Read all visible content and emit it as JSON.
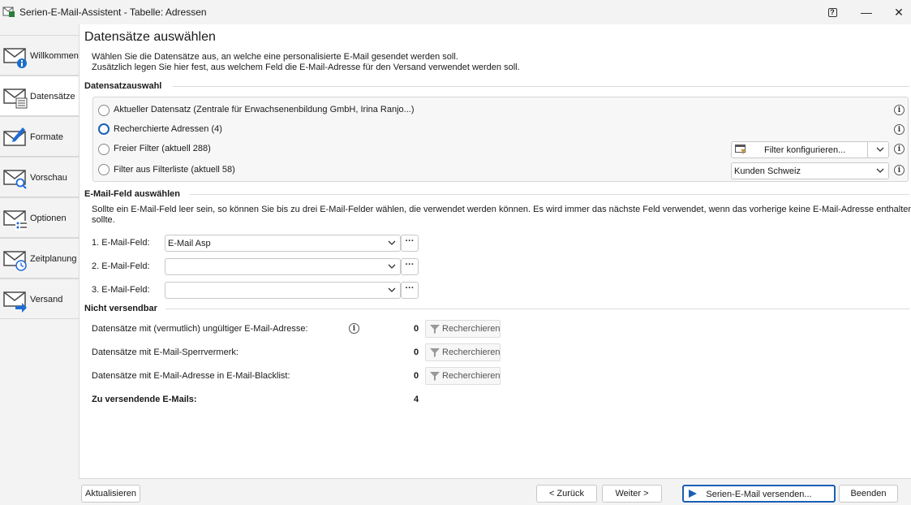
{
  "window": {
    "title": "Serien-E-Mail-Assistent - Tabelle: Adressen",
    "help_glyph": "?",
    "minimize_glyph": "—",
    "close_glyph": "✕"
  },
  "sidebar": {
    "items": [
      {
        "label": "Willkommen",
        "icon": "mail-info-icon"
      },
      {
        "label": "Datensätze",
        "icon": "mail-list-icon"
      },
      {
        "label": "Formate",
        "icon": "mail-edit-icon"
      },
      {
        "label": "Vorschau",
        "icon": "mail-search-icon"
      },
      {
        "label": "Optionen",
        "icon": "mail-options-icon"
      },
      {
        "label": "Zeitplanung",
        "icon": "mail-clock-icon"
      },
      {
        "label": "Versand",
        "icon": "mail-send-icon"
      }
    ]
  },
  "page": {
    "title": "Datensätze auswählen",
    "intro_line1": "Wählen Sie die Datensätze aus, an welche eine personalisierte E-Mail gesendet werden soll.",
    "intro_line2": "Zusätzlich legen Sie hier fest, aus welchem Feld die E-Mail-Adresse für den Versand verwendet werden soll."
  },
  "selection": {
    "heading": "Datensatzauswahl",
    "options": [
      {
        "label": "Aktueller Datensatz (Zentrale für Erwachsenenbildung GmbH, Irina Ranjo...)",
        "selected": false
      },
      {
        "label": "Recherchierte Adressen (4)",
        "selected": true
      },
      {
        "label": "Freier Filter (aktuell 288)",
        "selected": false
      },
      {
        "label": "Filter aus Filterliste (aktuell 58)",
        "selected": false
      }
    ],
    "filter_button_label": "Filter konfigurieren...",
    "filterlist_value": "Kunden Schweiz",
    "info_glyph": "i"
  },
  "email_fields": {
    "heading": "E-Mail-Feld auswählen",
    "description_line1": "Sollte ein E-Mail-Feld leer sein, so können Sie bis zu drei E-Mail-Felder wählen, die verwendet werden können. Es wird immer das nächste Feld verwendet, wenn das vorherige keine E-Mail-Adresse enthalten",
    "description_line2": "sollte.",
    "fields": [
      {
        "label": "1. E-Mail-Feld:",
        "value": "E-Mail Asp"
      },
      {
        "label": "2. E-Mail-Feld:",
        "value": ""
      },
      {
        "label": "3. E-Mail-Feld:",
        "value": ""
      }
    ],
    "ellipsis": "···"
  },
  "not_sendable": {
    "heading": "Nicht versendbar",
    "rows": [
      {
        "label": "Datensätze mit (vermutlich) ungültiger E-Mail-Adresse:",
        "count": "0",
        "button": "Recherchieren"
      },
      {
        "label": "Datensätze mit E-Mail-Sperrvermerk:",
        "count": "0",
        "button": "Recherchieren"
      },
      {
        "label": "Datensätze mit E-Mail-Adresse in E-Mail-Blacklist:",
        "count": "0",
        "button": "Recherchieren"
      }
    ],
    "total_label": "Zu versendende E-Mails:",
    "total_count": "4"
  },
  "footer": {
    "refresh": "Aktualisieren",
    "back": "< Zurück",
    "next": "Weiter >",
    "send": "Serien-E-Mail versenden...",
    "finish": "Beenden"
  },
  "colors": {
    "accent": "#1a5fb4",
    "envelope": "#4a4a4a",
    "info_badge": "#1a6fc9",
    "arrow_blue": "#1e6bd6"
  }
}
